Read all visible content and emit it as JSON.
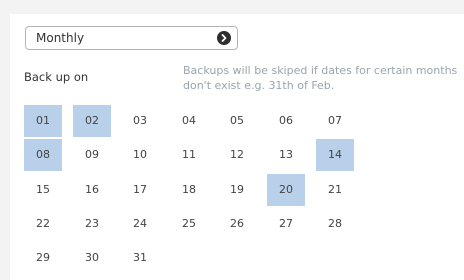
{
  "frequency_select": {
    "value": "Monthly"
  },
  "backup_on_label": "Back up on",
  "note": "Backups will be skiped if dates for certain months don't exist e.g. 31th of Feb.",
  "days": [
    {
      "label": "01",
      "selected": true
    },
    {
      "label": "02",
      "selected": true
    },
    {
      "label": "03",
      "selected": false
    },
    {
      "label": "04",
      "selected": false
    },
    {
      "label": "05",
      "selected": false
    },
    {
      "label": "06",
      "selected": false
    },
    {
      "label": "07",
      "selected": false
    },
    {
      "label": "08",
      "selected": true
    },
    {
      "label": "09",
      "selected": false
    },
    {
      "label": "10",
      "selected": false
    },
    {
      "label": "11",
      "selected": false
    },
    {
      "label": "12",
      "selected": false
    },
    {
      "label": "13",
      "selected": false
    },
    {
      "label": "14",
      "selected": true
    },
    {
      "label": "15",
      "selected": false
    },
    {
      "label": "16",
      "selected": false
    },
    {
      "label": "17",
      "selected": false
    },
    {
      "label": "18",
      "selected": false
    },
    {
      "label": "19",
      "selected": false
    },
    {
      "label": "20",
      "selected": true
    },
    {
      "label": "21",
      "selected": false
    },
    {
      "label": "22",
      "selected": false
    },
    {
      "label": "23",
      "selected": false
    },
    {
      "label": "24",
      "selected": false
    },
    {
      "label": "25",
      "selected": false
    },
    {
      "label": "26",
      "selected": false
    },
    {
      "label": "27",
      "selected": false
    },
    {
      "label": "28",
      "selected": false
    },
    {
      "label": "29",
      "selected": false
    },
    {
      "label": "30",
      "selected": false
    },
    {
      "label": "31",
      "selected": false
    }
  ],
  "colors": {
    "selected_bg": "#b9d0ea",
    "note_text": "#9aa4ad"
  }
}
